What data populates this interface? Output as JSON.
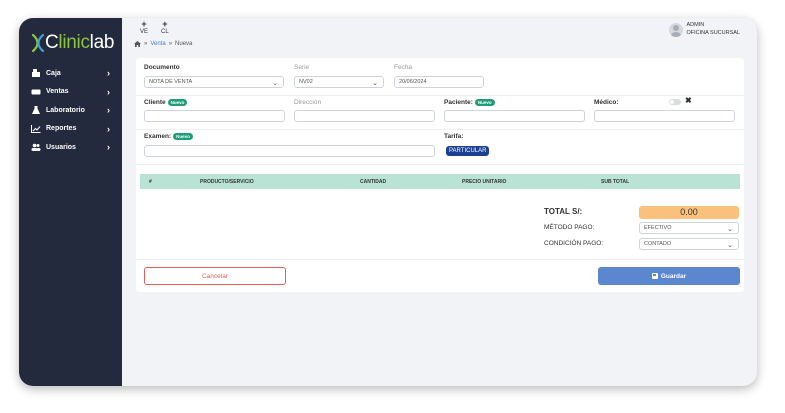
{
  "app": {
    "logo_prefix": "C",
    "logo_brand": "linic",
    "logo_suffix": "lab"
  },
  "sidebar": {
    "items": [
      {
        "label": "Caja",
        "icon": "cash-register-icon"
      },
      {
        "label": "Ventas",
        "icon": "ticket-icon"
      },
      {
        "label": "Laboratorio",
        "icon": "flask-icon"
      },
      {
        "label": "Reportes",
        "icon": "chart-line-icon"
      },
      {
        "label": "Usuarios",
        "icon": "users-icon"
      }
    ],
    "chevron": "›"
  },
  "topbar": {
    "quick": [
      {
        "plus": "+",
        "label": "VE"
      },
      {
        "plus": "+",
        "label": "CL"
      }
    ],
    "breadcrumb": {
      "sep": "»",
      "link": "Venta",
      "current": "Nueva"
    },
    "user": {
      "name": "ADMIN",
      "branch": "OFICINA SUCURSAL"
    }
  },
  "form": {
    "documento": {
      "label": "Documento",
      "value": "NOTA DE VENTA"
    },
    "serie": {
      "label": "Serie",
      "value": "NV02"
    },
    "fecha": {
      "label": "Fecha",
      "value": "20/06/2024"
    },
    "cliente": {
      "label": "Cliente",
      "badge": "Nuevo",
      "value": ""
    },
    "direccion": {
      "label": "Dirección",
      "value": ""
    },
    "paciente": {
      "label": "Paciente:",
      "badge": "Nuevo",
      "value": ""
    },
    "medico": {
      "label": "Médico:",
      "x": "✖",
      "value": ""
    },
    "examen": {
      "label": "Examen:",
      "badge": "Nuevo",
      "value": ""
    },
    "tarifa": {
      "label": "Tarifa:",
      "value": "PARTICULAR"
    }
  },
  "table": {
    "columns": [
      "#",
      "PRODUCTO/SERVICIO",
      "CANTIDAD",
      "PRECIO UNITARIO",
      "SUB TOTAL"
    ]
  },
  "totals": {
    "total_label": "TOTAL S/:",
    "total_value": "0.00",
    "metodo_label": "MÉTODO PAGO:",
    "metodo_value": "EFECTIVO",
    "condicion_label": "CONDICIÓN PAGO:",
    "condicion_value": "CONTADO"
  },
  "actions": {
    "cancel": "Cancelar",
    "save": "Guardar"
  },
  "colors": {
    "sidebar": "#232a3d",
    "brand_green": "#8cc63f",
    "badge_green": "#1f9d79",
    "table_header": "#b8e3d5",
    "total": "#f9c17b",
    "save": "#5b87cf",
    "cancel": "#e35d5d",
    "tarifa": "#1c3f94"
  }
}
